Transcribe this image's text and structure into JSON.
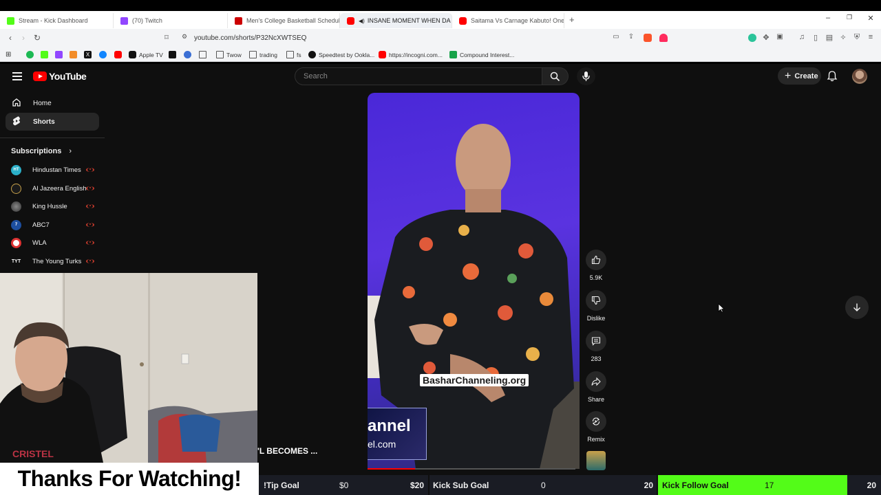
{
  "browser": {
    "tabs": [
      {
        "title": "Stream - Kick Dashboard",
        "color": "#53fc18"
      },
      {
        "title": "(70) Twitch",
        "color": "#9146ff"
      },
      {
        "title": "Men's College Basketball Schedule -",
        "color": "#d00"
      },
      {
        "title": "INSANE MOMENT WHEN DA",
        "color": "#ff0000",
        "active": true
      },
      {
        "title": "Saitama Vs Carnage Kabuto! One Pu",
        "color": "#ff0000"
      }
    ],
    "new_tab": "+",
    "url": "youtube.com/shorts/P32NcXWTSEQ",
    "bookmarks": [
      "Apple TV",
      "Twow",
      "trading",
      "fs",
      "Speedtest by Ookla...",
      "https://incogni.com...",
      "Compound Interest..."
    ]
  },
  "youtube": {
    "logo_text": "YouTube",
    "search_placeholder": "Search",
    "create_label": "Create",
    "nav": [
      {
        "label": "Home",
        "icon": "home-icon"
      },
      {
        "label": "Shorts",
        "icon": "shorts-icon",
        "selected": true
      }
    ],
    "subscriptions_label": "Subscriptions",
    "subscriptions": [
      {
        "name": "Hindustan Times",
        "color": "#2bb0c9",
        "abbr": "HT"
      },
      {
        "name": "Al Jazeera English",
        "color": "#1a1a1a",
        "abbr": ""
      },
      {
        "name": "King Hussle",
        "color": "#555",
        "abbr": ""
      },
      {
        "name": "ABC7",
        "color": "#1d4fa0",
        "abbr": "7"
      },
      {
        "name": "WLA",
        "color": "#fff",
        "abbr": ""
      },
      {
        "name": "The Young Turks",
        "color": "#0f0f0f",
        "abbr": "TYT"
      }
    ],
    "short": {
      "watermark": "BasharChanneling.org",
      "banner_line1": "annel",
      "banner_line2": "el.com",
      "title": "'L BECOMES ...",
      "progress": 0.23,
      "likes": "5.9K",
      "dislike_label": "Dislike",
      "comments": "283",
      "share_label": "Share",
      "remix_label": "Remix"
    }
  },
  "stream_overlay": {
    "thanks_text": "Thanks For Watching!",
    "goals": [
      {
        "label": "!Tip Goal",
        "current": "$0",
        "target": "$20",
        "fill": 0.0
      },
      {
        "label": "Kick Sub Goal",
        "current": "0",
        "target": "20",
        "fill": 0.0
      },
      {
        "label": "Kick Follow Goal",
        "current": "17",
        "target": "20",
        "fill": 0.85
      }
    ]
  }
}
